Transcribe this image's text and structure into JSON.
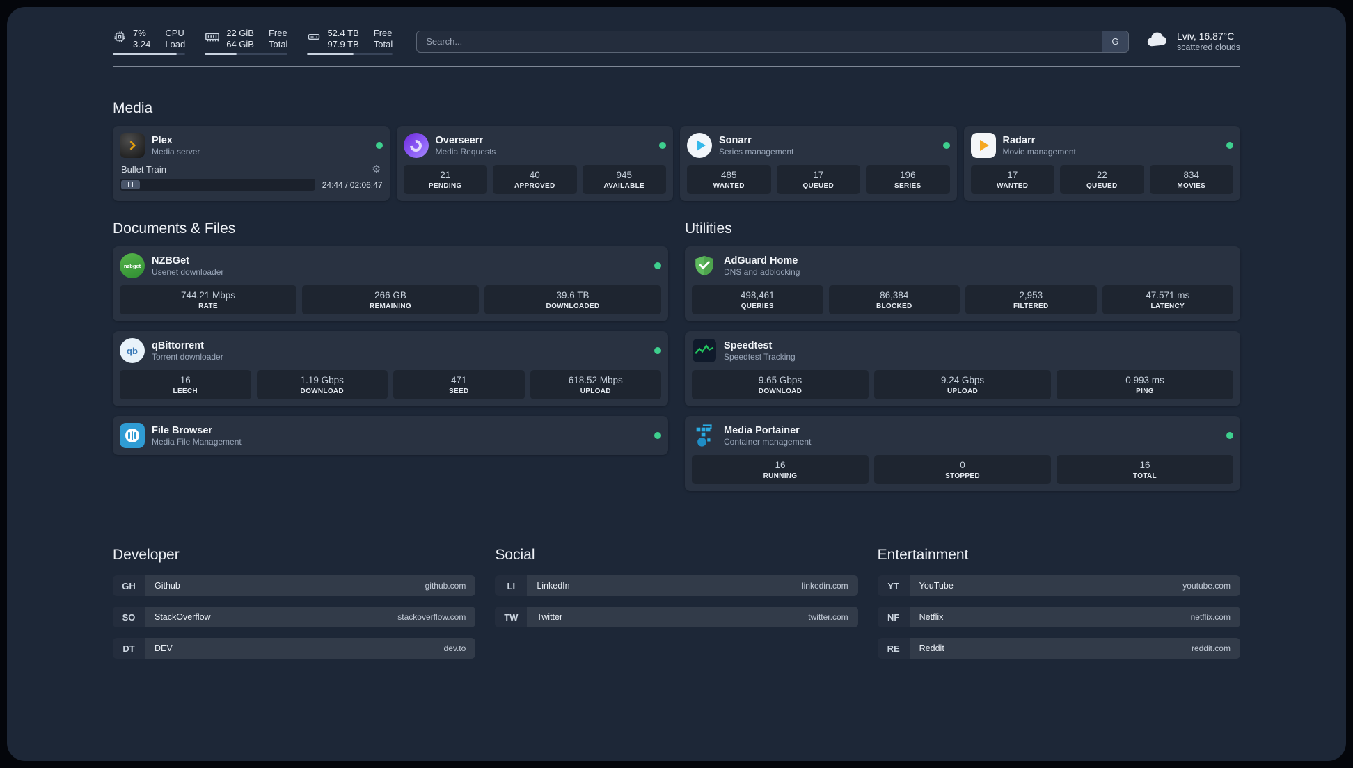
{
  "topbar": {
    "widgets": [
      {
        "value": "7%",
        "value2": "3.24",
        "label1": "CPU",
        "label2": "Load",
        "bar_css": "width:88%"
      },
      {
        "value": "22 GiB",
        "value2": "64 GiB",
        "label1": "Free",
        "label2": "Total",
        "bar_css": "width:38%"
      },
      {
        "value": "52.4 TB",
        "value2": "97.9 TB",
        "label1": "Free",
        "label2": "Total",
        "bar_css": "width:54%"
      }
    ],
    "search": {
      "placeholder": "Search...",
      "provider_button": "G"
    },
    "weather": {
      "location": "Lviv, 16.87°C",
      "condition": "scattered clouds"
    }
  },
  "icons": {
    "gear": "⚙",
    "qb_text": "qb",
    "nzbget_text": "nzbget"
  },
  "sections": {
    "media": {
      "title": "Media",
      "plex": {
        "name": "Plex",
        "desc": "Media server",
        "now_playing": "Bullet Train",
        "time": "24:44 / 02:06:47"
      },
      "overseerr": {
        "name": "Overseerr",
        "desc": "Media Requests",
        "stats": [
          {
            "value": "21",
            "label": "PENDING"
          },
          {
            "value": "40",
            "label": "APPROVED"
          },
          {
            "value": "945",
            "label": "AVAILABLE"
          }
        ]
      },
      "sonarr": {
        "name": "Sonarr",
        "desc": "Series management",
        "stats": [
          {
            "value": "485",
            "label": "WANTED"
          },
          {
            "value": "17",
            "label": "QUEUED"
          },
          {
            "value": "196",
            "label": "SERIES"
          }
        ]
      },
      "radarr": {
        "name": "Radarr",
        "desc": "Movie management",
        "stats": [
          {
            "value": "17",
            "label": "WANTED"
          },
          {
            "value": "22",
            "label": "QUEUED"
          },
          {
            "value": "834",
            "label": "MOVIES"
          }
        ]
      }
    },
    "documents": {
      "title": "Documents & Files",
      "nzbget": {
        "name": "NZBGet",
        "desc": "Usenet downloader",
        "stats": [
          {
            "value": "744.21 Mbps",
            "label": "RATE"
          },
          {
            "value": "266 GB",
            "label": "REMAINING"
          },
          {
            "value": "39.6 TB",
            "label": "DOWNLOADED"
          }
        ]
      },
      "qbittorrent": {
        "name": "qBittorrent",
        "desc": "Torrent downloader",
        "stats": [
          {
            "value": "16",
            "label": "LEECH"
          },
          {
            "value": "1.19 Gbps",
            "label": "DOWNLOAD"
          },
          {
            "value": "471",
            "label": "SEED"
          },
          {
            "value": "618.52 Mbps",
            "label": "UPLOAD"
          }
        ]
      },
      "filebrowser": {
        "name": "File Browser",
        "desc": "Media File Management"
      }
    },
    "utilities": {
      "title": "Utilities",
      "adguard": {
        "name": "AdGuard Home",
        "desc": "DNS and adblocking",
        "stats": [
          {
            "value": "498,461",
            "label": "QUERIES"
          },
          {
            "value": "86,384",
            "label": "BLOCKED"
          },
          {
            "value": "2,953",
            "label": "FILTERED"
          },
          {
            "value": "47.571 ms",
            "label": "LATENCY"
          }
        ]
      },
      "speedtest": {
        "name": "Speedtest",
        "desc": "Speedtest Tracking",
        "stats": [
          {
            "value": "9.65 Gbps",
            "label": "DOWNLOAD"
          },
          {
            "value": "9.24 Gbps",
            "label": "UPLOAD"
          },
          {
            "value": "0.993 ms",
            "label": "PING"
          }
        ]
      },
      "portainer": {
        "name": "Media Portainer",
        "desc": "Container management",
        "stats": [
          {
            "value": "16",
            "label": "RUNNING"
          },
          {
            "value": "0",
            "label": "STOPPED"
          },
          {
            "value": "16",
            "label": "TOTAL"
          }
        ]
      }
    },
    "bookmarks": {
      "developer": {
        "title": "Developer",
        "items": [
          {
            "abbr": "GH",
            "name": "Github",
            "url": "github.com"
          },
          {
            "abbr": "SO",
            "name": "StackOverflow",
            "url": "stackoverflow.com"
          },
          {
            "abbr": "DT",
            "name": "DEV",
            "url": "dev.to"
          }
        ]
      },
      "social": {
        "title": "Social",
        "items": [
          {
            "abbr": "LI",
            "name": "LinkedIn",
            "url": "linkedin.com"
          },
          {
            "abbr": "TW",
            "name": "Twitter",
            "url": "twitter.com"
          }
        ]
      },
      "entertainment": {
        "title": "Entertainment",
        "items": [
          {
            "abbr": "YT",
            "name": "YouTube",
            "url": "youtube.com"
          },
          {
            "abbr": "NF",
            "name": "Netflix",
            "url": "netflix.com"
          },
          {
            "abbr": "RE",
            "name": "Reddit",
            "url": "reddit.com"
          }
        ]
      }
    }
  }
}
